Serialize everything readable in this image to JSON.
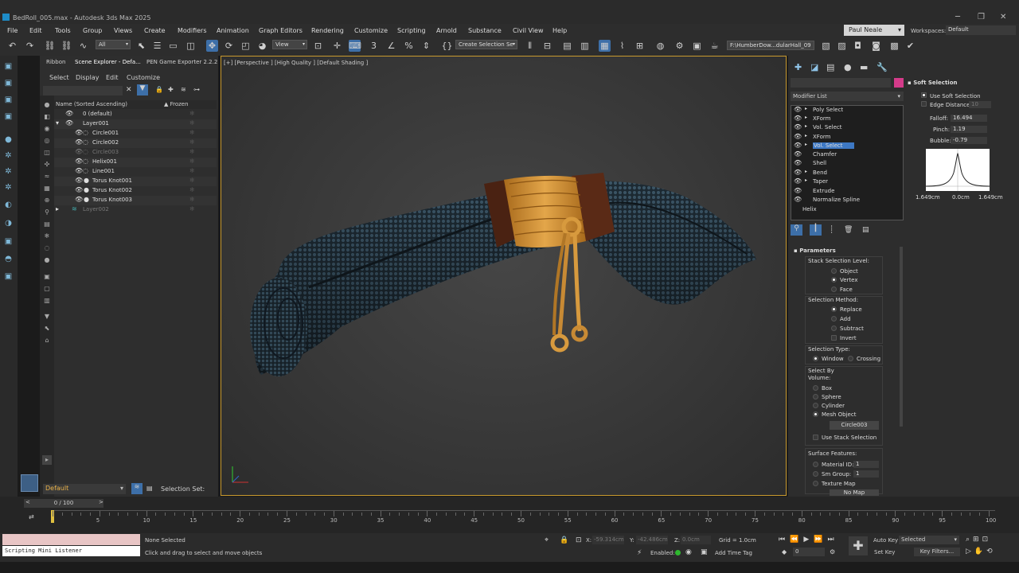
{
  "title": "BedRoll_005.max - Autodesk 3ds Max 2025",
  "menu": [
    "File",
    "Edit",
    "Tools",
    "Group",
    "Views",
    "Create",
    "Modifiers",
    "Animation",
    "Graph Editors",
    "Rendering",
    "Customize",
    "Scripting",
    "Arnold",
    "Substance",
    "Civil View",
    "Help"
  ],
  "user": "Paul Neale",
  "workspaces_label": "Workspaces:",
  "workspace": "Default",
  "toolbar": {
    "filter": "All",
    "ref_coord": "View",
    "create_selection_set": "Create Selection Se",
    "project_path": "F:\\HumberDow...dularHall_09"
  },
  "scene_explorer": {
    "tabs": [
      "Ribbon",
      "Scene Explorer - Defa...",
      "PEN Game Exporter 2.2.2"
    ],
    "menus": [
      "Select",
      "Display",
      "Edit",
      "Customize"
    ],
    "col_name": "Name (Sorted Ascending)",
    "col_frozen": "▲ Frozen",
    "rows": [
      "0 (default)",
      "Layer001",
      "Circle001",
      "Circle002",
      "Circle003",
      "Helix001",
      "Line001",
      "Torus Knot001",
      "Torus Knot002",
      "Torus Knot003",
      "Layer002"
    ],
    "layer_label": "Default",
    "selection_set_label": "Selection Set:"
  },
  "viewport": {
    "label": "[+] [Perspective ] [High Quality ] [Default Shading ]"
  },
  "command_panel": {
    "modifier_list": "Modifier List",
    "stack": [
      "Poly Select",
      "XForm",
      "Vol. Select",
      "XForm",
      "Vol. Select",
      "Chamfer",
      "Shell",
      "Bend",
      "Taper",
      "Extrude",
      "Normalize Spline",
      "Helix"
    ],
    "soft_selection": {
      "title": "Soft Selection",
      "use_soft": "Use Soft Selection",
      "edge_distance": "Edge Distance:",
      "edge_value": "10",
      "falloff_label": "Falloff:",
      "falloff": "16.494",
      "pinch_label": "Pinch:",
      "pinch": "1.19",
      "bubble_label": "Bubble:",
      "bubble": "-0.79",
      "curve_left": "1.649cm",
      "curve_mid": "0.0cm",
      "curve_right": "1.649cm"
    },
    "parameters": {
      "title": "Parameters",
      "stack_level": "Stack Selection Level:",
      "levels": [
        "Object",
        "Vertex",
        "Face"
      ],
      "method": "Selection Method:",
      "methods": [
        "Replace",
        "Add",
        "Subtract",
        "Invert"
      ],
      "type": "Selection Type:",
      "types": [
        "Window",
        "Crossing"
      ],
      "volume": "Select By Volume:",
      "volumes": [
        "Box",
        "Sphere",
        "Cylinder",
        "Mesh Object"
      ],
      "mesh_object": "Circle003",
      "use_stack": "Use Stack Selection",
      "surface": "Surface Features:",
      "material_id": "Material ID:",
      "material_val": "1",
      "sm_group": "Sm Group:",
      "sm_val": "1",
      "texture_map": "Texture Map",
      "no_map": "No Map"
    }
  },
  "timeline": {
    "frame": "0 / 100",
    "ticks": [
      "5",
      "10",
      "15",
      "20",
      "25",
      "30",
      "35",
      "40",
      "45",
      "50",
      "55",
      "60",
      "65",
      "70",
      "75",
      "80",
      "85",
      "90",
      "95",
      "100"
    ]
  },
  "status": {
    "listener": "Scripting Mini Listener",
    "none_selected": "None Selected",
    "prompt": "Click and drag to select and move objects",
    "x_label": "X:",
    "x": "-59.314cm",
    "y_label": "Y:",
    "y": "-42.486cm",
    "z_label": "Z:",
    "z": "0.0cm",
    "grid": "Grid = 1.0cm",
    "enabled": "Enabled:",
    "add_time_tag": "Add Time Tag",
    "auto_key": "Auto Key",
    "selected": "Selected",
    "set_key": "Set Key",
    "key_filters": "Key Filters...",
    "frame_field": "0"
  },
  "colors": {
    "accent": "#3d78c4",
    "viewport_border": "#c99a2e",
    "swatch": "#d43b8a"
  }
}
